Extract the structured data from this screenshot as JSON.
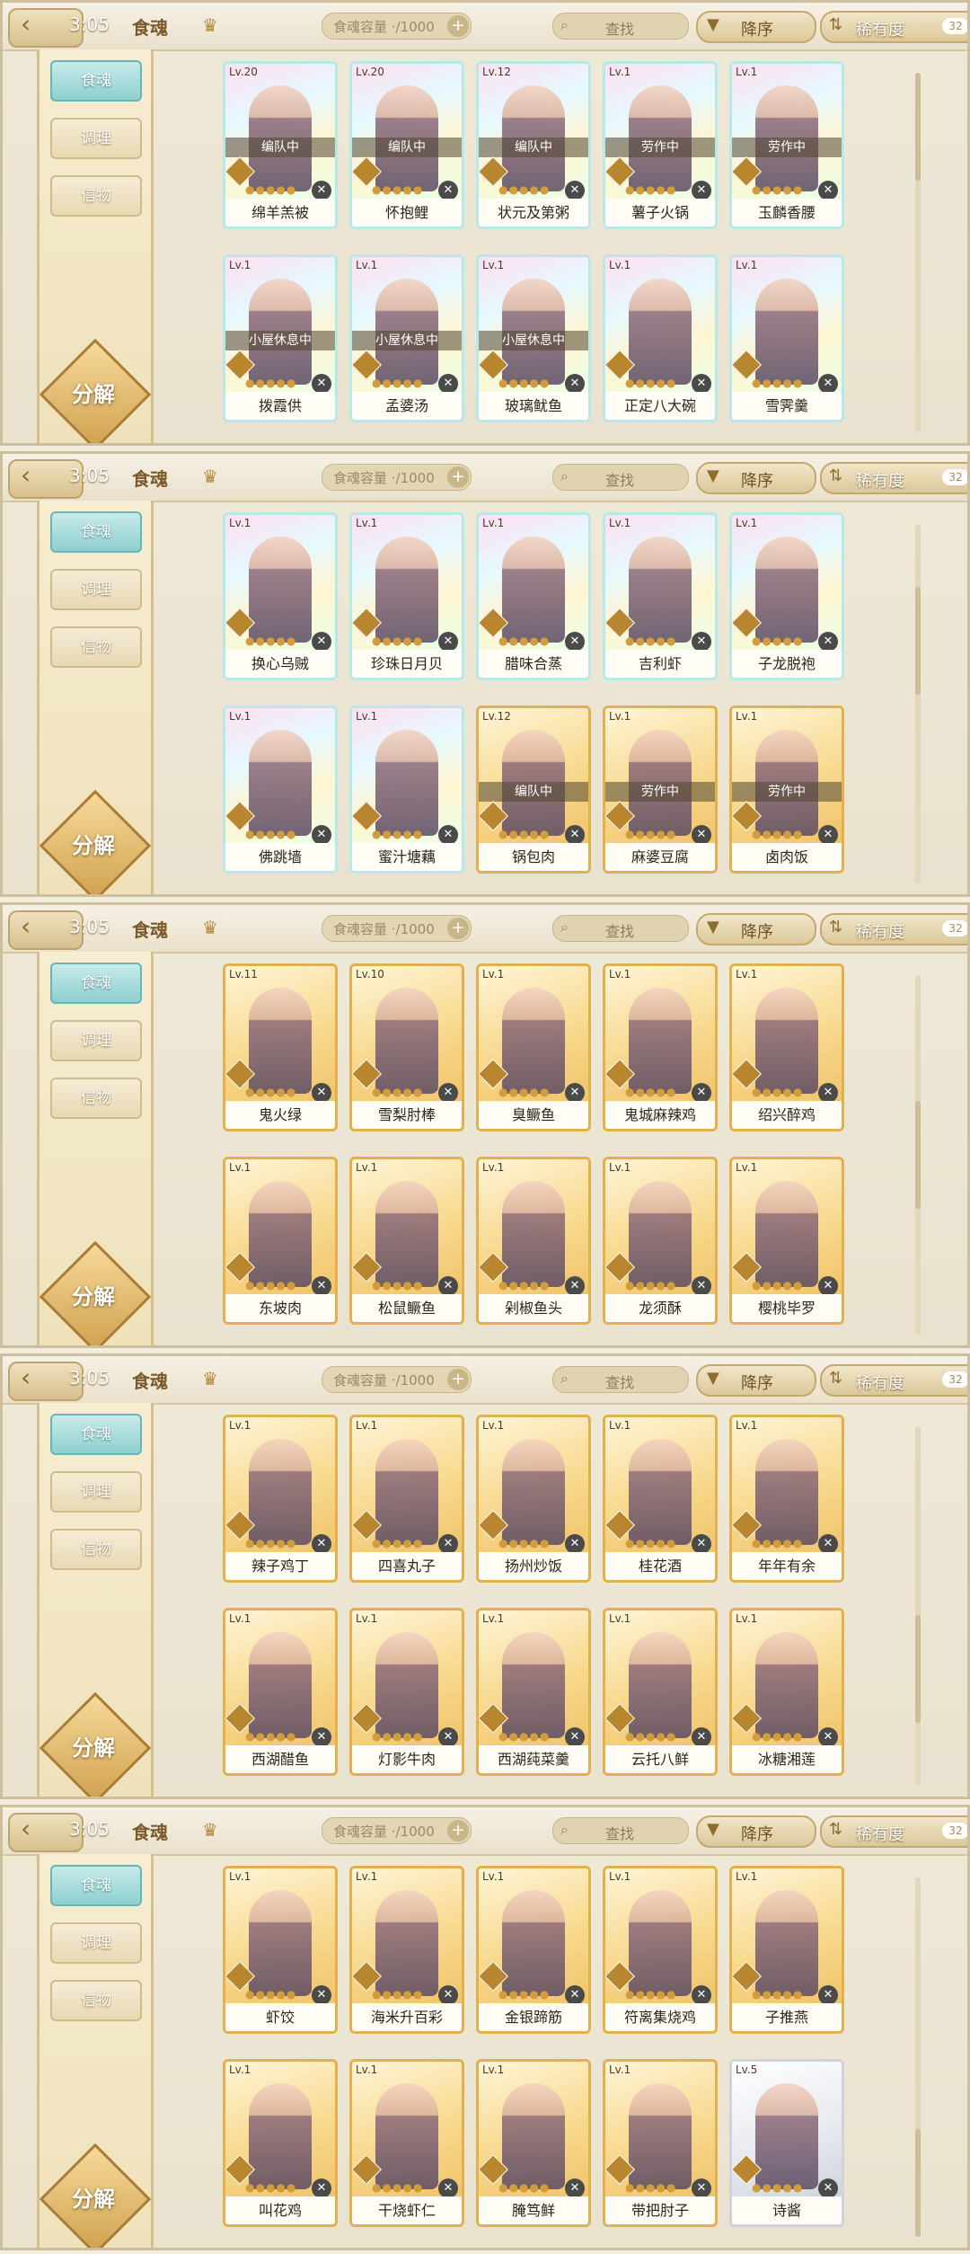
{
  "ui": {
    "time": "3:05",
    "tab_title": "食魂",
    "capacity_label": "食魂容量 ·/1000",
    "search_placeholder": "查找",
    "sort_label": "降序",
    "filter_label": "稀有度",
    "filter_count": "32",
    "sidebar": [
      "食魂",
      "调理",
      "信物"
    ],
    "decompose": "分解",
    "back_icon": "back-arrow-icon",
    "crown_icon": "crown-icon",
    "search_icon": "magnifier-icon",
    "sort_icon": "down-triangle-icon",
    "filter_icon": "filter-icon",
    "plus_icon": "plus-icon"
  },
  "panels": [
    {
      "cards": [
        {
          "lv": "Lv.20",
          "name": "绵羊羔被",
          "rarity": "rainbow",
          "status": "编队中"
        },
        {
          "lv": "Lv.20",
          "name": "怀抱鲤",
          "rarity": "rainbow",
          "status": "编队中"
        },
        {
          "lv": "Lv.12",
          "name": "状元及第粥",
          "rarity": "rainbow",
          "status": "编队中"
        },
        {
          "lv": "Lv.1",
          "name": "薯子火锅",
          "rarity": "rainbow",
          "status": "劳作中"
        },
        {
          "lv": "Lv.1",
          "name": "玉麟香腰",
          "rarity": "rainbow",
          "status": "劳作中"
        },
        {
          "lv": "Lv.1",
          "name": "拨霞供",
          "rarity": "rainbow",
          "status": "小屋休息中"
        },
        {
          "lv": "Lv.1",
          "name": "孟婆汤",
          "rarity": "rainbow",
          "status": "小屋休息中"
        },
        {
          "lv": "Lv.1",
          "name": "玻璃鱿鱼",
          "rarity": "rainbow",
          "status": "小屋休息中"
        },
        {
          "lv": "Lv.1",
          "name": "正定八大碗",
          "rarity": "rainbow",
          "status": ""
        },
        {
          "lv": "Lv.1",
          "name": "雪霁羹",
          "rarity": "rainbow",
          "status": ""
        }
      ]
    },
    {
      "cards": [
        {
          "lv": "Lv.1",
          "name": "换心乌贼",
          "rarity": "rainbow",
          "status": ""
        },
        {
          "lv": "Lv.1",
          "name": "珍珠日月贝",
          "rarity": "rainbow",
          "status": ""
        },
        {
          "lv": "Lv.1",
          "name": "腊味合蒸",
          "rarity": "rainbow",
          "status": ""
        },
        {
          "lv": "Lv.1",
          "name": "吉利虾",
          "rarity": "rainbow",
          "status": ""
        },
        {
          "lv": "Lv.1",
          "name": "子龙脱袍",
          "rarity": "rainbow",
          "status": ""
        },
        {
          "lv": "Lv.1",
          "name": "佛跳墙",
          "rarity": "rainbow",
          "status": ""
        },
        {
          "lv": "Lv.1",
          "name": "蜜汁塘藕",
          "rarity": "rainbow",
          "status": ""
        },
        {
          "lv": "Lv.12",
          "name": "锅包肉",
          "rarity": "gold",
          "status": "编队中"
        },
        {
          "lv": "Lv.1",
          "name": "麻婆豆腐",
          "rarity": "gold",
          "status": "劳作中"
        },
        {
          "lv": "Lv.1",
          "name": "卤肉饭",
          "rarity": "gold",
          "status": "劳作中"
        }
      ]
    },
    {
      "cards": [
        {
          "lv": "Lv.11",
          "name": "鬼火绿",
          "rarity": "gold",
          "status": ""
        },
        {
          "lv": "Lv.10",
          "name": "雪梨肘棒",
          "rarity": "gold",
          "status": ""
        },
        {
          "lv": "Lv.1",
          "name": "臭鳜鱼",
          "rarity": "gold",
          "status": ""
        },
        {
          "lv": "Lv.1",
          "name": "鬼城麻辣鸡",
          "rarity": "gold",
          "status": ""
        },
        {
          "lv": "Lv.1",
          "name": "绍兴醉鸡",
          "rarity": "gold",
          "status": ""
        },
        {
          "lv": "Lv.1",
          "name": "东坡肉",
          "rarity": "gold",
          "status": ""
        },
        {
          "lv": "Lv.1",
          "name": "松鼠鳜鱼",
          "rarity": "gold",
          "status": ""
        },
        {
          "lv": "Lv.1",
          "name": "剁椒鱼头",
          "rarity": "gold",
          "status": ""
        },
        {
          "lv": "Lv.1",
          "name": "龙须酥",
          "rarity": "gold",
          "status": ""
        },
        {
          "lv": "Lv.1",
          "name": "樱桃毕罗",
          "rarity": "gold",
          "status": ""
        }
      ]
    },
    {
      "cards": [
        {
          "lv": "Lv.1",
          "name": "辣子鸡丁",
          "rarity": "gold",
          "status": ""
        },
        {
          "lv": "Lv.1",
          "name": "四喜丸子",
          "rarity": "gold",
          "status": ""
        },
        {
          "lv": "Lv.1",
          "name": "扬州炒饭",
          "rarity": "gold",
          "status": ""
        },
        {
          "lv": "Lv.1",
          "name": "桂花酒",
          "rarity": "gold",
          "status": ""
        },
        {
          "lv": "Lv.1",
          "name": "年年有余",
          "rarity": "gold",
          "status": ""
        },
        {
          "lv": "Lv.1",
          "name": "西湖醋鱼",
          "rarity": "gold",
          "status": ""
        },
        {
          "lv": "Lv.1",
          "name": "灯影牛肉",
          "rarity": "gold",
          "status": ""
        },
        {
          "lv": "Lv.1",
          "name": "西湖莼菜羹",
          "rarity": "gold",
          "status": ""
        },
        {
          "lv": "Lv.1",
          "name": "云托八鲜",
          "rarity": "gold",
          "status": ""
        },
        {
          "lv": "Lv.1",
          "name": "冰糖湘莲",
          "rarity": "gold",
          "status": ""
        }
      ]
    },
    {
      "cards": [
        {
          "lv": "Lv.1",
          "name": "虾饺",
          "rarity": "gold",
          "status": ""
        },
        {
          "lv": "Lv.1",
          "name": "海米升百彩",
          "rarity": "gold",
          "status": ""
        },
        {
          "lv": "Lv.1",
          "name": "金银蹄筋",
          "rarity": "gold",
          "status": ""
        },
        {
          "lv": "Lv.1",
          "name": "符离集烧鸡",
          "rarity": "gold",
          "status": ""
        },
        {
          "lv": "Lv.1",
          "name": "子推燕",
          "rarity": "gold",
          "status": ""
        },
        {
          "lv": "Lv.1",
          "name": "叫花鸡",
          "rarity": "gold",
          "status": ""
        },
        {
          "lv": "Lv.1",
          "name": "干烧虾仁",
          "rarity": "gold",
          "status": ""
        },
        {
          "lv": "Lv.1",
          "name": "腌笃鲜",
          "rarity": "gold",
          "status": ""
        },
        {
          "lv": "Lv.1",
          "name": "带把肘子",
          "rarity": "gold",
          "status": ""
        },
        {
          "lv": "Lv.5",
          "name": "诗酱",
          "rarity": "silver",
          "status": ""
        }
      ]
    }
  ]
}
